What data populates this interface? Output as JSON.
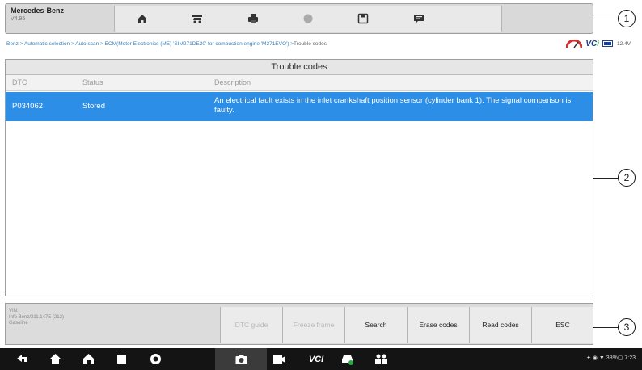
{
  "brand": {
    "title": "Mercedes-Benz",
    "version": "V4.95"
  },
  "toolbar": {
    "icons": [
      "home-icon",
      "vehicle-swap-icon",
      "print-icon",
      "help-icon",
      "save-icon",
      "data-logging-icon"
    ],
    "colors": {
      "bar": "#d9d9d9",
      "icon": "#333333"
    }
  },
  "breadcrumb": {
    "path": "Benz > Automatic selection > Auto scan > ECM(Motor Electronics (ME) 'SIM271DE20' for combustion engine 'M271EVO') > ",
    "current": "Trouble codes",
    "voltage": "12.4V",
    "vci_text": "VC",
    "vci_suffix": "i"
  },
  "panel": {
    "title": "Trouble codes",
    "columns": [
      "DTC",
      "Status",
      "Description"
    ],
    "rows": [
      {
        "dtc": "P034062",
        "status": "Stored",
        "description": "An electrical fault exists in the inlet crankshaft position sensor (cylinder bank 1). The signal comparison is faulty.",
        "selected": true
      }
    ],
    "colors": {
      "selected_row": "#2c8ee6"
    }
  },
  "vehicle_info": {
    "line1": "VIN:",
    "line2": "Info Benz/211.147E (212)",
    "line3": "Gasoline"
  },
  "buttons": [
    {
      "label": "DTC guide",
      "enabled": false
    },
    {
      "label": "Freeze frame",
      "enabled": false
    },
    {
      "label": "Search",
      "enabled": true
    },
    {
      "label": "Erase codes",
      "enabled": true
    },
    {
      "label": "Read codes",
      "enabled": true
    },
    {
      "label": "ESC",
      "enabled": true
    }
  ],
  "navbar": {
    "icons": [
      "back-icon",
      "home-icon",
      "autel-home-icon",
      "recent-apps-icon",
      "browser-icon",
      "camera-icon",
      "screen-record-icon",
      "vci-icon",
      "vehicle-icon",
      "remote-expert-icon"
    ],
    "vci_label": "VCI",
    "status": "✦ ◉ ▼ 38%▢ 7:23"
  },
  "callouts": [
    "1",
    "2",
    "3"
  ]
}
